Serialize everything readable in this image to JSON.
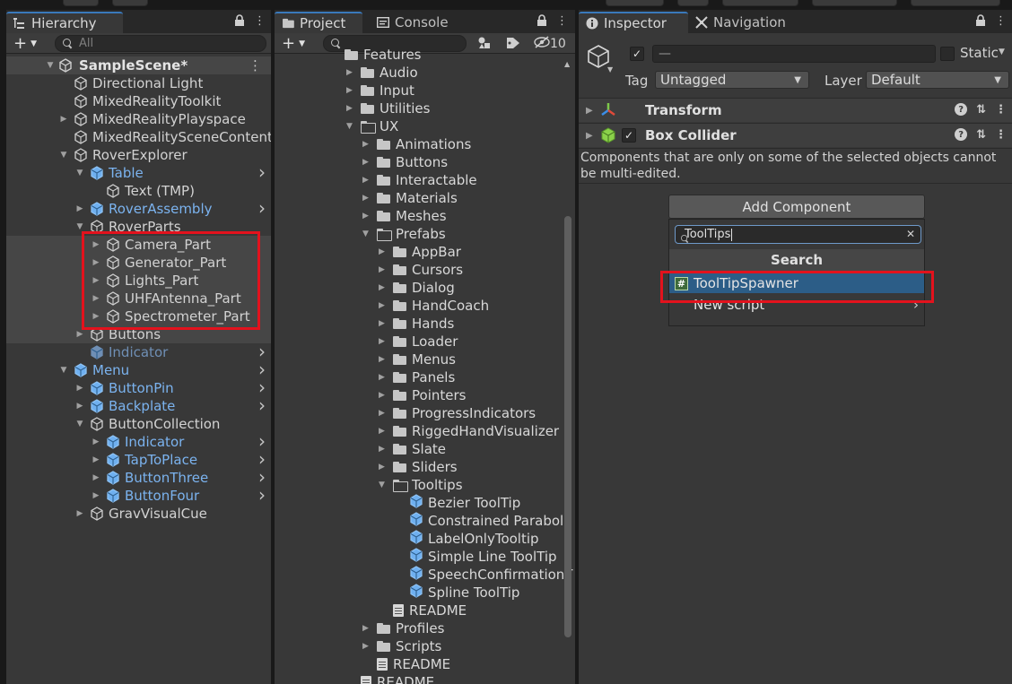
{
  "hierarchy": {
    "tab_label": "Hierarchy",
    "search_placeholder": "All",
    "scene_name": "SampleScene*",
    "rows": [
      {
        "label": "Directional Light",
        "prefab": false,
        "arrow": ""
      },
      {
        "label": "MixedRealityToolkit",
        "prefab": false,
        "arrow": ""
      },
      {
        "label": "MixedRealityPlayspace",
        "prefab": false,
        "arrow": "right"
      },
      {
        "label": "MixedRealitySceneContent",
        "prefab": false,
        "arrow": ""
      },
      {
        "label": "RoverExplorer",
        "prefab": false,
        "arrow": "down"
      },
      {
        "label": "Table",
        "prefab": true,
        "arrow": "down"
      },
      {
        "label": "Text (TMP)",
        "prefab": false,
        "arrow": ""
      },
      {
        "label": "RoverAssembly",
        "prefab": true,
        "arrow": "right"
      },
      {
        "label": "RoverParts",
        "prefab": false,
        "arrow": "down"
      },
      {
        "label": "Camera_Part",
        "prefab": false,
        "arrow": "right"
      },
      {
        "label": "Generator_Part",
        "prefab": false,
        "arrow": "right"
      },
      {
        "label": "Lights_Part",
        "prefab": false,
        "arrow": "right"
      },
      {
        "label": "UHFAntenna_Part",
        "prefab": false,
        "arrow": "right"
      },
      {
        "label": "Spectrometer_Part",
        "prefab": false,
        "arrow": "right"
      },
      {
        "label": "Buttons",
        "prefab": false,
        "arrow": "right"
      },
      {
        "label": "Indicator",
        "prefab": true,
        "arrow": ""
      },
      {
        "label": "Menu",
        "prefab": true,
        "arrow": "down"
      },
      {
        "label": "ButtonPin",
        "prefab": true,
        "arrow": "right"
      },
      {
        "label": "Backplate",
        "prefab": true,
        "arrow": "right"
      },
      {
        "label": "ButtonCollection",
        "prefab": false,
        "arrow": "down"
      },
      {
        "label": "Indicator",
        "prefab": true,
        "arrow": "right"
      },
      {
        "label": "TapToPlace",
        "prefab": true,
        "arrow": "right"
      },
      {
        "label": "ButtonThree",
        "prefab": true,
        "arrow": "right"
      },
      {
        "label": "ButtonFour",
        "prefab": true,
        "arrow": "right"
      },
      {
        "label": "GravVisualCue",
        "prefab": false,
        "arrow": "right"
      }
    ]
  },
  "project": {
    "tab_label": "Project",
    "console_tab_label": "Console",
    "hidden_count": "10",
    "rows": [
      {
        "label": "Features",
        "type": "folder"
      },
      {
        "label": "Audio",
        "type": "folder"
      },
      {
        "label": "Input",
        "type": "folder"
      },
      {
        "label": "Utilities",
        "type": "folder"
      },
      {
        "label": "UX",
        "type": "folder-open"
      },
      {
        "label": "Animations",
        "type": "folder"
      },
      {
        "label": "Buttons",
        "type": "folder"
      },
      {
        "label": "Interactable",
        "type": "folder"
      },
      {
        "label": "Materials",
        "type": "folder"
      },
      {
        "label": "Meshes",
        "type": "folder"
      },
      {
        "label": "Prefabs",
        "type": "folder-open"
      },
      {
        "label": "AppBar",
        "type": "folder"
      },
      {
        "label": "Cursors",
        "type": "folder"
      },
      {
        "label": "Dialog",
        "type": "folder"
      },
      {
        "label": "HandCoach",
        "type": "folder"
      },
      {
        "label": "Hands",
        "type": "folder"
      },
      {
        "label": "Loader",
        "type": "folder"
      },
      {
        "label": "Menus",
        "type": "folder"
      },
      {
        "label": "Panels",
        "type": "folder"
      },
      {
        "label": "Pointers",
        "type": "folder"
      },
      {
        "label": "ProgressIndicators",
        "type": "folder"
      },
      {
        "label": "RiggedHandVisualizer",
        "type": "folder"
      },
      {
        "label": "Slate",
        "type": "folder"
      },
      {
        "label": "Sliders",
        "type": "folder"
      },
      {
        "label": "Tooltips",
        "type": "folder-open"
      },
      {
        "label": "Bezier ToolTip",
        "type": "prefab"
      },
      {
        "label": "Constrained Parabola",
        "type": "prefab"
      },
      {
        "label": "LabelOnlyTooltip",
        "type": "prefab"
      },
      {
        "label": "Simple Line ToolTip",
        "type": "prefab"
      },
      {
        "label": "SpeechConfirmationT",
        "type": "prefab"
      },
      {
        "label": "Spline ToolTip",
        "type": "prefab"
      },
      {
        "label": "README",
        "type": "doc"
      },
      {
        "label": "Profiles",
        "type": "folder"
      },
      {
        "label": "Scripts",
        "type": "folder"
      },
      {
        "label": "README",
        "type": "doc"
      },
      {
        "label": "README",
        "type": "doc"
      }
    ]
  },
  "inspector": {
    "tab_label": "Inspector",
    "nav_tab_label": "Navigation",
    "name_value": "—",
    "static_label": "Static",
    "tag_label": "Tag",
    "tag_value": "Untagged",
    "layer_label": "Layer",
    "layer_value": "Default",
    "components": [
      {
        "label": "Transform"
      },
      {
        "label": "Box Collider"
      }
    ],
    "multi_edit_note": "Components that are only on some of the selected objects cannot be multi-edited.",
    "add_component_label": "Add Component",
    "search_value": "ToolTips",
    "search_header": "Search",
    "results": [
      {
        "label": "ToolTipSpawner",
        "selected": true
      },
      {
        "label": "New script",
        "selected": false
      }
    ]
  },
  "colors": {
    "panel_bg": "#383838",
    "prefab_blue": "#7bb3ef",
    "highlight_red": "#e3121d",
    "selection_blue": "#2c5d87"
  }
}
